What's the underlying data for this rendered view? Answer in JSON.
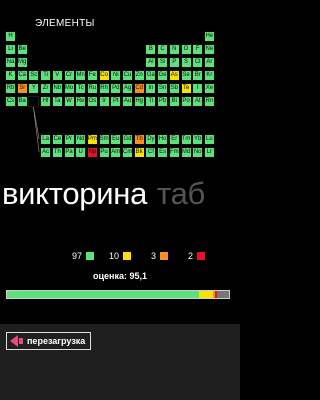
{
  "app": {
    "title": "ЭЛЕМЕНТЫ"
  },
  "colors": {
    "correct": "#5ee07b",
    "yellow": "#f5e400",
    "orange": "#f7921e",
    "red": "#e81123",
    "bar_bg": "#777777",
    "bar_border": "#cccccc"
  },
  "periodic_table": {
    "rows": [
      [
        {
          "s": "H",
          "st": "g"
        },
        {
          "s": "He",
          "st": "g"
        }
      ],
      [
        {
          "s": "Li",
          "st": "g"
        },
        {
          "s": "Be",
          "st": "g"
        },
        {
          "s": "B",
          "st": "g"
        },
        {
          "s": "C",
          "st": "g"
        },
        {
          "s": "N",
          "st": "g"
        },
        {
          "s": "O",
          "st": "g"
        },
        {
          "s": "F",
          "st": "g"
        },
        {
          "s": "Ne",
          "st": "g"
        }
      ],
      [
        {
          "s": "Na",
          "st": "g"
        },
        {
          "s": "Mg",
          "st": "g"
        },
        {
          "s": "Al",
          "st": "g"
        },
        {
          "s": "Si",
          "st": "g"
        },
        {
          "s": "P",
          "st": "g"
        },
        {
          "s": "S",
          "st": "g"
        },
        {
          "s": "Cl",
          "st": "g"
        },
        {
          "s": "Ar",
          "st": "g"
        }
      ],
      [
        {
          "s": "K",
          "st": "g"
        },
        {
          "s": "Ca",
          "st": "g"
        },
        {
          "s": "Sc",
          "st": "g"
        },
        {
          "s": "Ti",
          "st": "g"
        },
        {
          "s": "V",
          "st": "g"
        },
        {
          "s": "Cr",
          "st": "g"
        },
        {
          "s": "Mn",
          "st": "g"
        },
        {
          "s": "Fe",
          "st": "g"
        },
        {
          "s": "Co",
          "st": "y"
        },
        {
          "s": "Ni",
          "st": "g"
        },
        {
          "s": "Cu",
          "st": "g"
        },
        {
          "s": "Zn",
          "st": "g"
        },
        {
          "s": "Ga",
          "st": "g"
        },
        {
          "s": "Ge",
          "st": "g"
        },
        {
          "s": "As",
          "st": "y"
        },
        {
          "s": "Se",
          "st": "g"
        },
        {
          "s": "Br",
          "st": "g"
        },
        {
          "s": "Kr",
          "st": "g"
        }
      ],
      [
        {
          "s": "Rb",
          "st": "g"
        },
        {
          "s": "Sr",
          "st": "o"
        },
        {
          "s": "Y",
          "st": "g"
        },
        {
          "s": "Zr",
          "st": "g"
        },
        {
          "s": "Nb",
          "st": "g"
        },
        {
          "s": "Mo",
          "st": "g"
        },
        {
          "s": "Tc",
          "st": "g"
        },
        {
          "s": "Ru",
          "st": "g"
        },
        {
          "s": "Rh",
          "st": "g"
        },
        {
          "s": "Pd",
          "st": "g"
        },
        {
          "s": "Ag",
          "st": "g"
        },
        {
          "s": "Cd",
          "st": "o"
        },
        {
          "s": "In",
          "st": "g"
        },
        {
          "s": "Sn",
          "st": "g"
        },
        {
          "s": "Sb",
          "st": "g"
        },
        {
          "s": "Te",
          "st": "y"
        },
        {
          "s": "I",
          "st": "g"
        },
        {
          "s": "Xe",
          "st": "g"
        }
      ],
      [
        {
          "s": "Cs",
          "st": "g"
        },
        {
          "s": "Ba",
          "st": "g"
        },
        {
          "s": "",
          "st": "b"
        },
        {
          "s": "Hf",
          "st": "g"
        },
        {
          "s": "Ta",
          "st": "g"
        },
        {
          "s": "W",
          "st": "g"
        },
        {
          "s": "Re",
          "st": "g"
        },
        {
          "s": "Os",
          "st": "g"
        },
        {
          "s": "Ir",
          "st": "g"
        },
        {
          "s": "Pt",
          "st": "g"
        },
        {
          "s": "Au",
          "st": "g"
        },
        {
          "s": "Hg",
          "st": "g"
        },
        {
          "s": "Tl",
          "st": "g"
        },
        {
          "s": "Pb",
          "st": "g"
        },
        {
          "s": "Bi",
          "st": "g"
        },
        {
          "s": "Po",
          "st": "g"
        },
        {
          "s": "At",
          "st": "g"
        },
        {
          "s": "Rn",
          "st": "g"
        }
      ]
    ],
    "lanthanides": [
      {
        "s": "La",
        "st": "g"
      },
      {
        "s": "Ce",
        "st": "g"
      },
      {
        "s": "Pr",
        "st": "g"
      },
      {
        "s": "Nd",
        "st": "g"
      },
      {
        "s": "Pm",
        "st": "y"
      },
      {
        "s": "Sm",
        "st": "g"
      },
      {
        "s": "Eu",
        "st": "g"
      },
      {
        "s": "Gd",
        "st": "g"
      },
      {
        "s": "Tb",
        "st": "o"
      },
      {
        "s": "Dy",
        "st": "g"
      },
      {
        "s": "Ho",
        "st": "g"
      },
      {
        "s": "Er",
        "st": "g"
      },
      {
        "s": "Tm",
        "st": "g"
      },
      {
        "s": "Yb",
        "st": "g"
      },
      {
        "s": "Lu",
        "st": "g"
      }
    ],
    "actinides": [
      {
        "s": "Ac",
        "st": "g"
      },
      {
        "s": "Th",
        "st": "g"
      },
      {
        "s": "Pa",
        "st": "g"
      },
      {
        "s": "U",
        "st": "g"
      },
      {
        "s": "Np",
        "st": "r"
      },
      {
        "s": "Pu",
        "st": "g"
      },
      {
        "s": "Am",
        "st": "g"
      },
      {
        "s": "Cm",
        "st": "g"
      },
      {
        "s": "Bk",
        "st": "y"
      },
      {
        "s": "Cf",
        "st": "g"
      },
      {
        "s": "Es",
        "st": "g"
      },
      {
        "s": "Fm",
        "st": "g"
      },
      {
        "s": "Md",
        "st": "g"
      },
      {
        "s": "No",
        "st": "g"
      },
      {
        "s": "Lr",
        "st": "g"
      }
    ]
  },
  "pivot": {
    "active": "викторина",
    "next": "таб"
  },
  "stats": [
    {
      "count": "97",
      "color": "#5ee07b",
      "name": "correct"
    },
    {
      "count": "10",
      "color": "#f5e400",
      "name": "yellow"
    },
    {
      "count": "3",
      "color": "#f7921e",
      "name": "orange"
    },
    {
      "count": "2",
      "color": "#e81123",
      "name": "red"
    }
  ],
  "score": {
    "label": "оценка: 95,1"
  },
  "progress": [
    {
      "fraction": 0.866,
      "color": "#5ee07b"
    },
    {
      "fraction": 0.06,
      "color": "#f5e400"
    },
    {
      "fraction": 0.012,
      "color": "#f7921e"
    },
    {
      "fraction": 0.009,
      "color": "#e81123"
    }
  ],
  "bottom": {
    "reset_label": "перезагрузка"
  }
}
